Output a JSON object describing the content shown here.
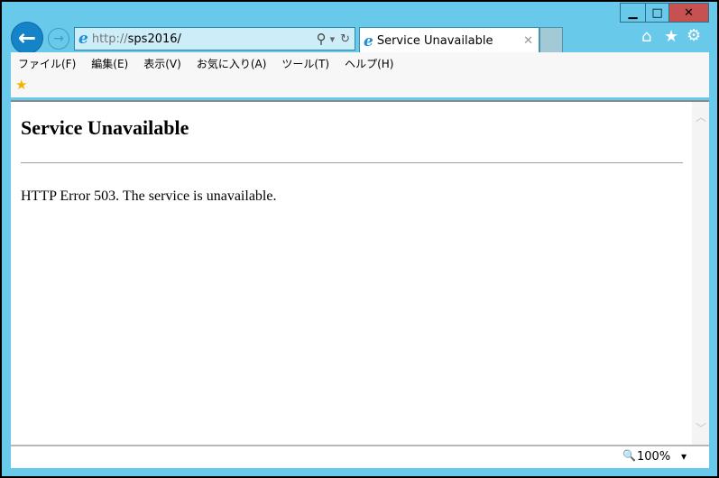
{
  "window": {
    "minimize": "▁",
    "maximize": "□",
    "close": "✕"
  },
  "nav": {
    "back": "back-icon",
    "forward": "forward-icon"
  },
  "address": {
    "url_prefix": "http://",
    "url_host": "sps2016/",
    "search_icon": "⚲",
    "dropdown": "▾",
    "refresh": "↻"
  },
  "tab": {
    "title": "Service Unavailable",
    "close": "✕"
  },
  "toolbar_icons": {
    "home": "⌂",
    "favorites": "★",
    "tools": "⚙"
  },
  "menu": [
    "ファイル(F)",
    "編集(E)",
    "表示(V)",
    "お気に入り(A)",
    "ツール(T)",
    "ヘルプ(H)"
  ],
  "page": {
    "heading": "Service Unavailable",
    "message": "HTTP Error 503. The service is unavailable."
  },
  "status": {
    "zoom": "100%",
    "zoom_dropdown": "▾"
  },
  "colors": {
    "frame": "#68c9eb",
    "close_button": "#c75050",
    "accent": "#1583c7"
  }
}
